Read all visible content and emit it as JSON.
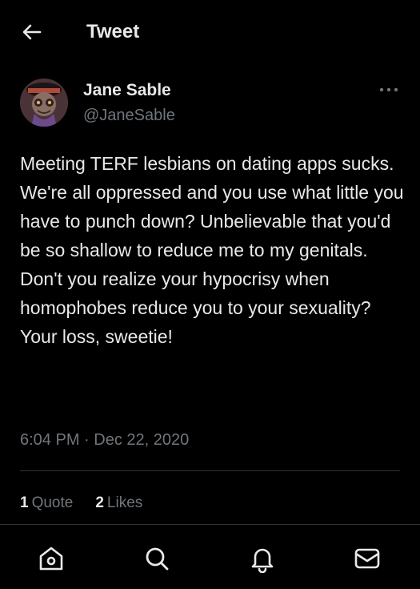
{
  "header": {
    "title": "Tweet",
    "back_icon": "arrow-left-icon"
  },
  "tweet": {
    "author": {
      "display_name": "Jane Sable",
      "handle": "@JaneSable",
      "avatar": "avatar-image"
    },
    "more_icon": "more-horizontal-icon",
    "text": "Meeting TERF lesbians on dating apps sucks. We're all oppressed and you use what little you have to punch down? Unbelievable that you'd be so shallow to reduce me to my genitals. Don't you realize your hypocrisy when homophobes reduce you to your sexuality?\nYour loss, sweetie!",
    "time": "6:04 PM",
    "separator": "·",
    "date": "Dec 22, 2020",
    "stats": {
      "quotes_count": "1",
      "quotes_label": "Quote",
      "likes_count": "2",
      "likes_label": "Likes"
    }
  },
  "bottom_nav": {
    "items": [
      {
        "name": "home",
        "icon": "home-icon"
      },
      {
        "name": "search",
        "icon": "search-icon"
      },
      {
        "name": "notifications",
        "icon": "bell-icon"
      },
      {
        "name": "messages",
        "icon": "mail-icon"
      }
    ]
  },
  "colors": {
    "background": "#000000",
    "text_primary": "#e7e9ea",
    "text_secondary": "#71767b",
    "divider": "#2f3336"
  }
}
